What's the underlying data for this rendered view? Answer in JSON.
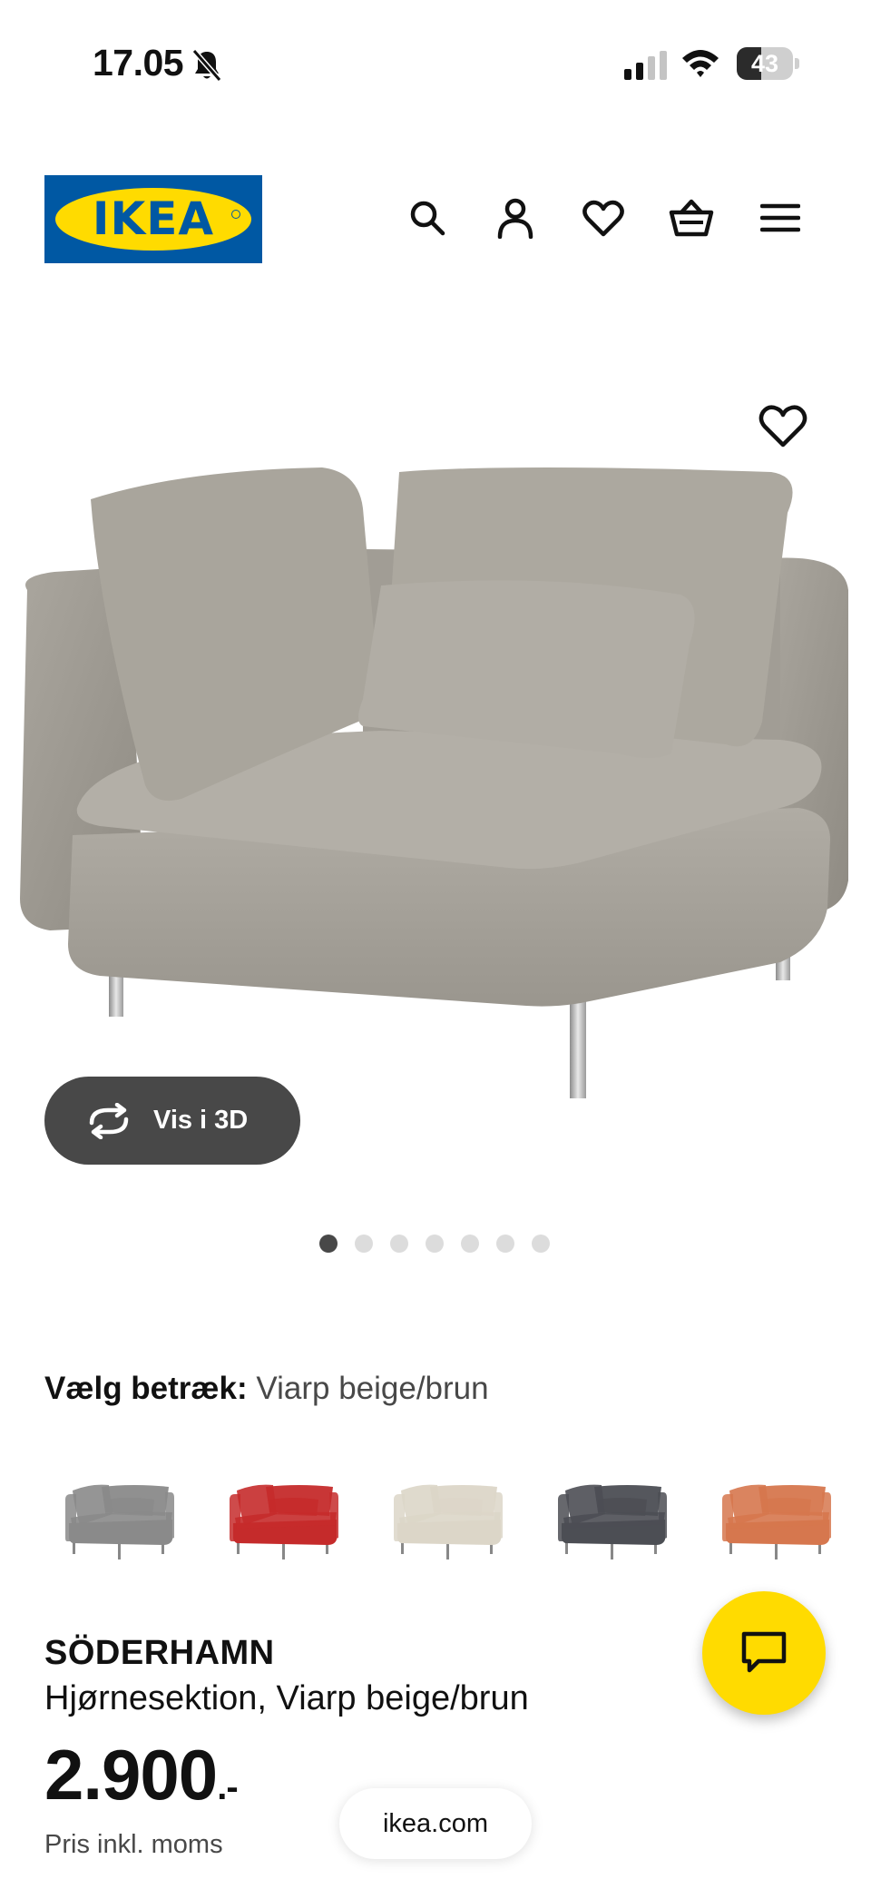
{
  "status_bar": {
    "time": "17.05",
    "battery_level": "43",
    "battery_fraction": 0.43
  },
  "header": {
    "logo_text": "IKEA",
    "icons": [
      "search-icon",
      "account-icon",
      "heart-icon",
      "basket-icon",
      "menu-icon"
    ]
  },
  "gallery": {
    "vis3d_label": "Vis i 3D",
    "dot_count": 7,
    "active_dot": 1
  },
  "cover": {
    "label": "Vælg betræk:",
    "value": "Viarp beige/brun",
    "swatches": [
      {
        "name": "grey",
        "color": "#8a8a8a"
      },
      {
        "name": "red",
        "color": "#c52b2b"
      },
      {
        "name": "beige",
        "color": "#dcd6c8"
      },
      {
        "name": "dark-grey",
        "color": "#4c4e54"
      },
      {
        "name": "orange",
        "color": "#d6774e"
      }
    ]
  },
  "product": {
    "name": "SÖDERHAMN",
    "description": "Hjørnesektion, Viarp beige/brun",
    "price": "2.900",
    "price_suffix": ".-",
    "price_note": "Pris inkl. moms"
  },
  "browser": {
    "url": "ikea.com"
  },
  "colors": {
    "ikea_blue": "#0058a3",
    "ikea_yellow": "#ffdb00",
    "dark_button": "#484848"
  }
}
